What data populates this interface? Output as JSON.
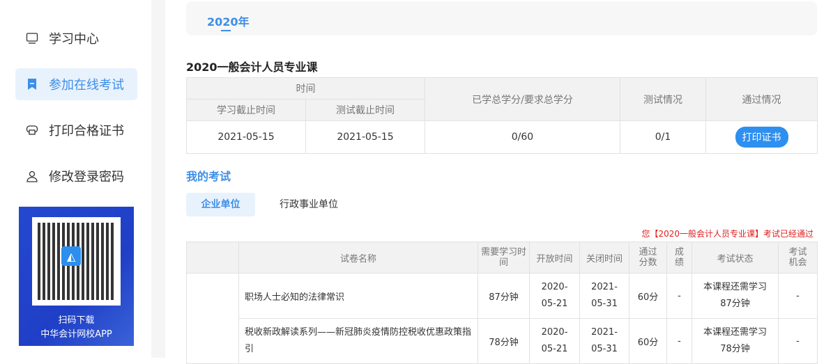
{
  "sidebar": {
    "items": [
      {
        "label": "学习中心",
        "icon": "monitor-icon"
      },
      {
        "label": "参加在线考试",
        "icon": "bookmark-icon",
        "active": true
      },
      {
        "label": "打印合格证书",
        "icon": "printer-icon"
      },
      {
        "label": "修改登录密码",
        "icon": "user-icon"
      }
    ],
    "promo": {
      "line1": "扫码下载",
      "line2": "中华会计网校APP"
    }
  },
  "year_tab": "2020年",
  "course": {
    "title": "2020一般会计人员专业课",
    "headers": {
      "time": "时间",
      "study_deadline": "学习截止时间",
      "test_deadline": "测试截止时间",
      "credits": "已学总学分/要求总学分",
      "test_status": "测试情况",
      "pass_status": "通过情况"
    },
    "row": {
      "study_deadline": "2021-05-15",
      "test_deadline": "2021-05-15",
      "credits": "0/60",
      "test_status": "0/1",
      "print_button": "打印证书"
    }
  },
  "my_exams": {
    "title": "我的考试",
    "tabs": [
      "企业单位",
      "行政事业单位"
    ],
    "notice": "您【2020一般会计人员专业课】考试已经通过",
    "headers": [
      "试卷名称",
      "需要学习时间",
      "开放时间",
      "关闭时间",
      "通过分数",
      "成绩",
      "考试状态",
      "考试机会"
    ],
    "rows": [
      {
        "name": "职场人士必知的法律常识",
        "study_time": "87分钟",
        "open": "2020-05-21",
        "close": "2021-05-31",
        "pass_score": "60分",
        "score": "-",
        "status": "本课程还需学习87分钟",
        "chances": "-"
      },
      {
        "name": "税收新政解读系列——新冠肺炎疫情防控税收优惠政策指引",
        "study_time": "78分钟",
        "open": "2020-05-21",
        "close": "2021-05-31",
        "pass_score": "60分",
        "score": "-",
        "status": "本课程还需学习78分钟",
        "chances": "-"
      }
    ]
  }
}
